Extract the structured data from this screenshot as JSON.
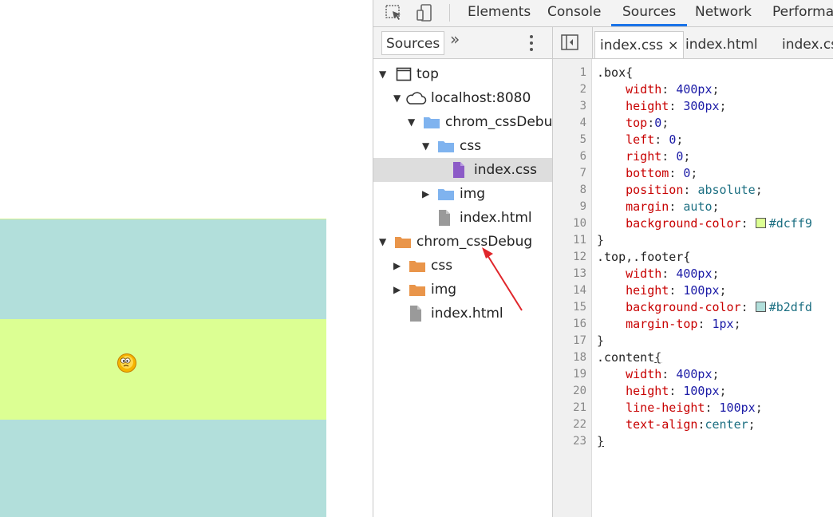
{
  "toolbar": {
    "tabs": [
      "Elements",
      "Console",
      "Sources",
      "Network",
      "Performar"
    ],
    "active_tab": "Sources"
  },
  "navigator": {
    "tab_label": "Sources",
    "more_label": "»",
    "tree": [
      {
        "label": "top",
        "icon": "frame-icon",
        "expanded": true
      },
      {
        "label": "localhost:8080",
        "icon": "cloud-icon",
        "expanded": true
      },
      {
        "label": "chrom_cssDebug",
        "icon": "folder-blue-icon",
        "expanded": true
      },
      {
        "label": "css",
        "icon": "folder-blue-icon",
        "expanded": true
      },
      {
        "label": "index.css",
        "icon": "css-file-icon",
        "selected": true
      },
      {
        "label": "img",
        "icon": "folder-blue-icon",
        "expanded": false
      },
      {
        "label": "index.html",
        "icon": "file-icon"
      },
      {
        "label": "chrom_cssDebug",
        "icon": "folder-orange-icon",
        "expanded": true
      },
      {
        "label": "css",
        "icon": "folder-orange-icon",
        "expanded": false
      },
      {
        "label": "img",
        "icon": "folder-orange-icon",
        "expanded": false
      },
      {
        "label": "index.html",
        "icon": "file-icon"
      }
    ]
  },
  "editor": {
    "file_tabs": [
      "index.css",
      "index.html",
      "index.css"
    ],
    "close_glyph": "×",
    "line_numbers": [
      "1",
      "2",
      "3",
      "4",
      "5",
      "6",
      "7",
      "8",
      "9",
      "10",
      "11",
      "12",
      "13",
      "14",
      "15",
      "16",
      "17",
      "18",
      "19",
      "20",
      "21",
      "22",
      "23"
    ],
    "code": {
      "l1_sel": ".box{",
      "l2_prop": "width",
      "l2_val": "400px",
      "l3_prop": "height",
      "l3_val": "300px",
      "l4_prop": "top",
      "l4_val": "0",
      "l5_prop": "left",
      "l5_val": "0",
      "l6_prop": "right",
      "l6_val": "0",
      "l7_prop": "bottom",
      "l7_val": "0",
      "l8_prop": "position",
      "l8_val": "absolute",
      "l9_prop": "margin",
      "l9_val": "auto",
      "l10_prop": "background-color",
      "l10_val": "#dcff9",
      "l11": "}",
      "l12_sel": ".top,.footer{",
      "l13_prop": "width",
      "l13_val": "400px",
      "l14_prop": "height",
      "l14_val": "100px",
      "l15_prop": "background-color",
      "l15_val": "#b2dfd",
      "l16_prop": "margin-top",
      "l16_val": "1px",
      "l17": "}",
      "l18_sel": ".content",
      "l18_brace": "{",
      "l19_prop": "width",
      "l19_val": "400px",
      "l20_prop": "height",
      "l20_val": "100px",
      "l21_prop": "line-height",
      "l21_val": "100px",
      "l22_prop": "text-align",
      "l22_val": "center",
      "l23": "}"
    }
  },
  "colors": {
    "swatch_green": "#dcff93",
    "swatch_teal": "#b2dfdb",
    "preview_teal": "#b2dfdb",
    "preview_green": "#dcff93",
    "arrow": "#e0262b",
    "active_tab_underline": "#1a73e8"
  }
}
